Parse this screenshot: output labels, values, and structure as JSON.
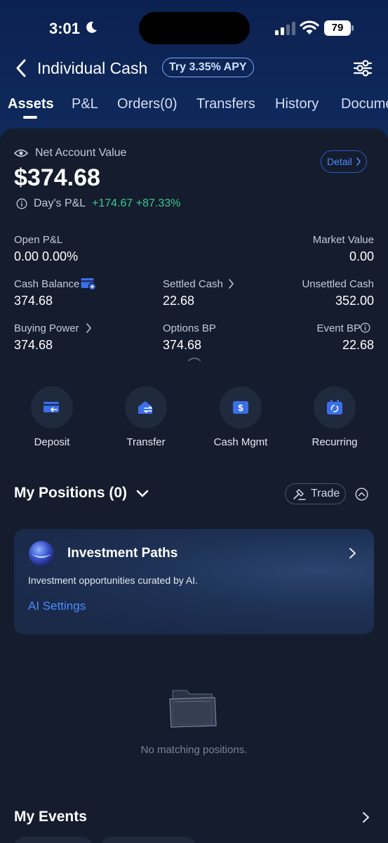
{
  "status_bar": {
    "time": "3:01",
    "battery": "79"
  },
  "nav": {
    "title": "Individual Cash",
    "apy_badge": "Try 3.35% APY"
  },
  "tabs": [
    "Assets",
    "P&L",
    "Orders(0)",
    "Transfers",
    "History",
    "Docume"
  ],
  "account": {
    "net_label": "Net Account Value",
    "net_value": "$374.68",
    "detail_label": "Detail",
    "days_pl_label": "Day's P&L",
    "days_pl_value": "+174.67 +87.33%"
  },
  "metrics": {
    "open_pl_label": "Open P&L",
    "open_pl_value": "0.00 0.00%",
    "market_value_label": "Market Value",
    "market_value_value": "0.00",
    "cash_balance_label": "Cash Balance",
    "cash_balance_value": "374.68",
    "settled_cash_label": "Settled Cash",
    "settled_cash_value": "22.68",
    "unsettled_cash_label": "Unsettled Cash",
    "unsettled_cash_value": "352.00",
    "buying_power_label": "Buying Power",
    "buying_power_value": "374.68",
    "options_bp_label": "Options BP",
    "options_bp_value": "374.68",
    "event_bp_label": "Event BP",
    "event_bp_value": "22.68"
  },
  "actions": [
    {
      "label": "Deposit",
      "icon": "deposit-card-icon"
    },
    {
      "label": "Transfer",
      "icon": "transfer-house-icon"
    },
    {
      "label": "Cash Mgmt",
      "icon": "dollar-wallet-icon"
    },
    {
      "label": "Recurring",
      "icon": "recurring-calendar-icon"
    }
  ],
  "positions": {
    "title": "My Positions (0)",
    "trade_label": "Trade",
    "empty_text": "No matching positions."
  },
  "investment_paths": {
    "title": "Investment Paths",
    "description": "Investment opportunities curated by AI.",
    "settings_link": "AI Settings"
  },
  "events": {
    "title": "My Events"
  },
  "colors": {
    "accent_blue": "#4d8bff",
    "gain_green": "#3cc88c",
    "header_bg": "#0c2151",
    "card_bg": "#141c2e"
  }
}
